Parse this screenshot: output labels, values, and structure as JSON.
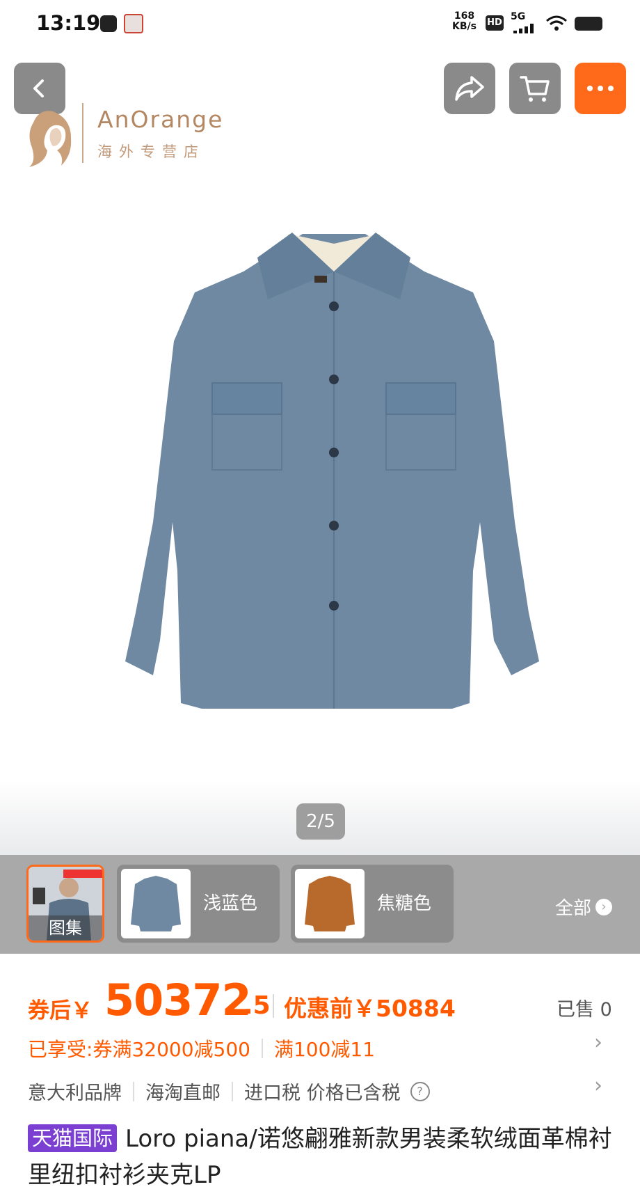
{
  "status_bar": {
    "time": "13:19",
    "net_speed": "168",
    "net_unit": "KB/s",
    "hd": "HD",
    "network": "5G"
  },
  "top_buttons": {
    "back_icon": "chevron-left-icon",
    "share_icon": "share-arrow-icon",
    "cart_icon": "cart-icon",
    "more_icon": "more-dots-icon"
  },
  "store": {
    "name": "AnOrange",
    "subtitle": "海外专营店"
  },
  "gallery": {
    "counter": "2/5"
  },
  "variants": {
    "gallery_label": "图集",
    "items": [
      {
        "label": "浅蓝色",
        "color": "#6f89a3"
      },
      {
        "label": "焦糖色",
        "color": "#b86a2c"
      }
    ],
    "all_label": "全部"
  },
  "price": {
    "prefix": "券后￥",
    "integer": "50372",
    "decimal": ".5",
    "before": "优惠前￥50884",
    "sold": "已售 0",
    "accent": "#ff5a00"
  },
  "promo": {
    "label": "已享受: ",
    "coupon": "券满32000减500",
    "discount": "满100减11"
  },
  "info": {
    "brand": "意大利品牌",
    "shipping": "海淘直邮",
    "tax": "进口税 价格已含税"
  },
  "title": {
    "tag": "天猫国际",
    "text": "Loro piana/诺悠翩雅新款男装柔软绒面革棉衬里纽扣衬衫夹克LP",
    "tag_color": "#7b3fd1"
  }
}
